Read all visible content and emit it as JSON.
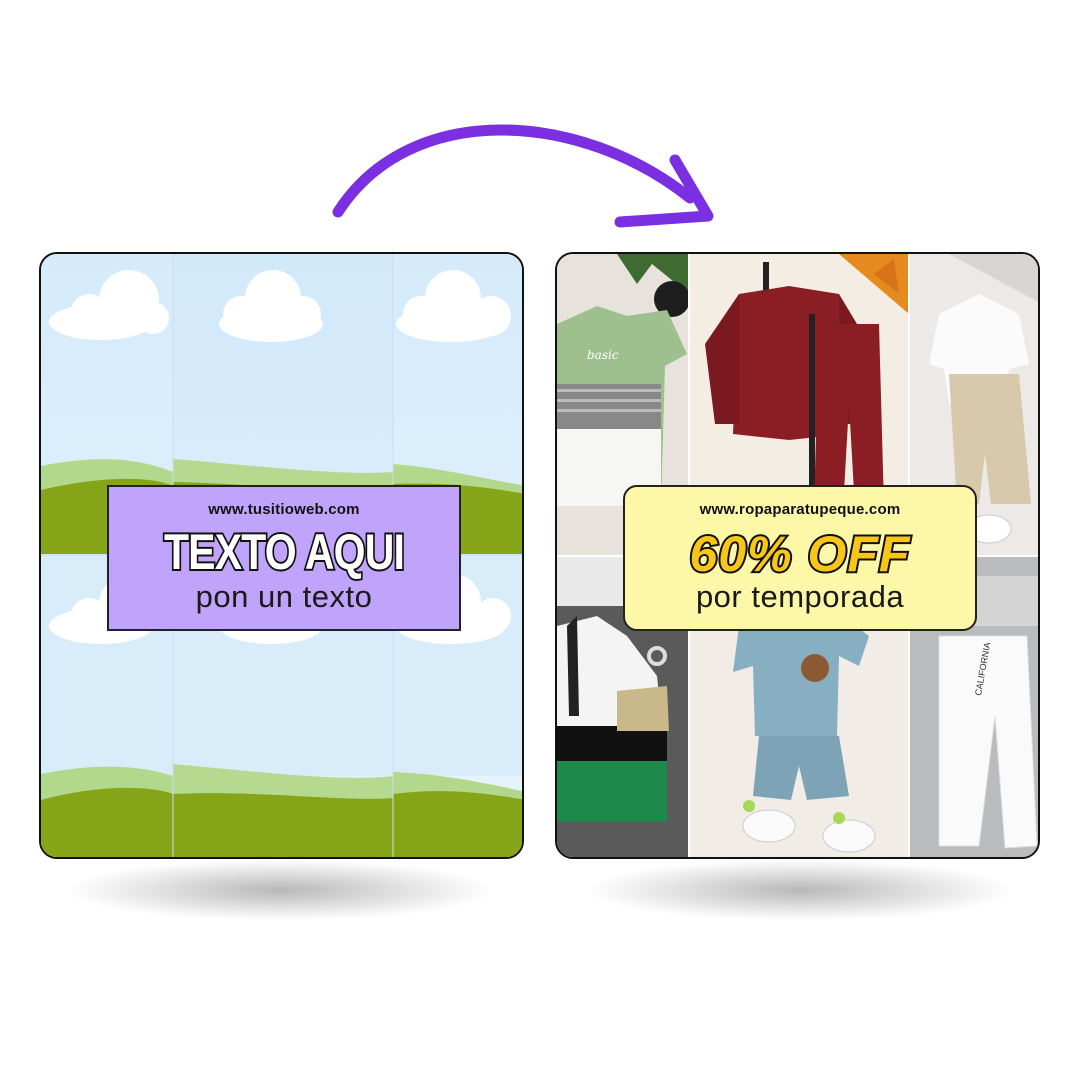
{
  "left_card": {
    "url": "www.tusitioweb.com",
    "headline": "TEXTO AQUI",
    "subtext": "pon un texto",
    "label_color": "#c0a3fb"
  },
  "right_card": {
    "url": "www.ropaparatupeque.com",
    "headline": "60% OFF",
    "subtext": "por temporada",
    "label_color": "#fdf7a8",
    "headline_color": "#f7c617",
    "photos": [
      "green-striped-tshirt",
      "burgundy-sweatsuit",
      "overalls-set",
      "colorblock-hoodie",
      "blue-shirt-shorts-set",
      "white-joggers"
    ]
  },
  "arrow_color": "#7a2fe0"
}
